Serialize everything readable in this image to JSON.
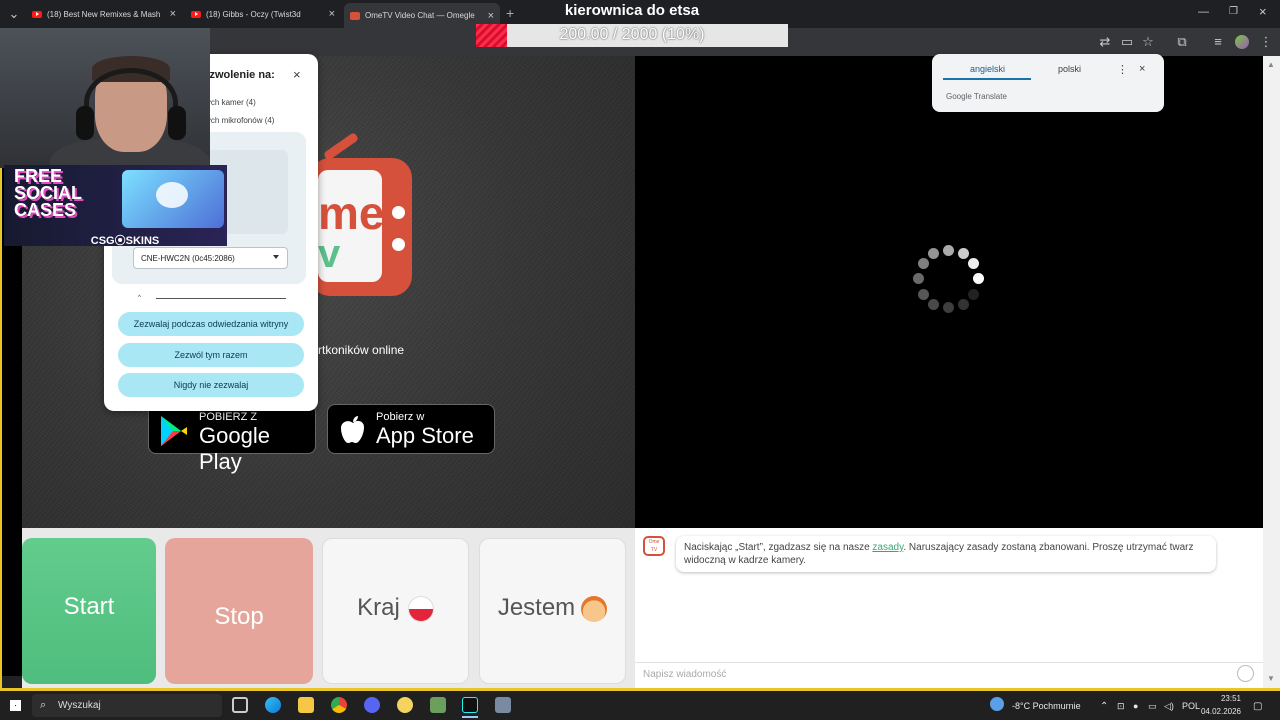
{
  "browser": {
    "tabs": [
      {
        "label": "(18) Best New Remixes & Mash"
      },
      {
        "label": "(18) Gibbs - Oczy (Twist3d"
      },
      {
        "label": "OmeTV Video Chat — Omegle"
      }
    ]
  },
  "overlay": {
    "title": "kierownica do etsa",
    "progress_text": "200.00 / 2000 (10%)",
    "progress_fraction": 0.1
  },
  "ad": {
    "headline": "FREE SOCIAL CASES",
    "brand": "CSG⦿SKINS"
  },
  "permission_popup": {
    "title": "pozwolenie na:",
    "camera_line": "pnych kamer (4)",
    "mic_line": "pnych mikrofonów (4)",
    "camera_select": "CNE-HWC2N (0c45:2086)",
    "buttons": [
      {
        "label": "Zezwalaj podczas odwiedzania witryny"
      },
      {
        "label": "Zezwól tym razem"
      },
      {
        "label": "Nigdy nie zezwalaj"
      }
    ]
  },
  "logo": {
    "text1": "me",
    "text2": "v"
  },
  "online_text": "rtkoników online",
  "stores": {
    "google_small": "POBIERZ Z",
    "google_big": "Google Play",
    "apple_small": "Pobierz w",
    "apple_big": "App Store"
  },
  "translate": {
    "active_lang": "angielski",
    "other_lang": "polski",
    "brand": "Google Translate"
  },
  "controls": {
    "start": "Start",
    "stop": "Stop",
    "country": "Kraj",
    "gender": "Jestem"
  },
  "chat": {
    "avatar": "Ome TV",
    "msg_before": "Naciskając „Start”, zgadzasz się na nasze ",
    "msg_link": "zasady",
    "msg_after": ". Naruszający zasady zostaną zbanowani. Proszę utrzymać twarz widoczną w kadrze kamery.",
    "placeholder": "Napisz wiadomość"
  },
  "taskbar": {
    "search": "Wyszukaj",
    "weather": "-8°C  Pochmurnie",
    "lang": "POL",
    "time": "23:51",
    "date": "04.02.2026"
  }
}
